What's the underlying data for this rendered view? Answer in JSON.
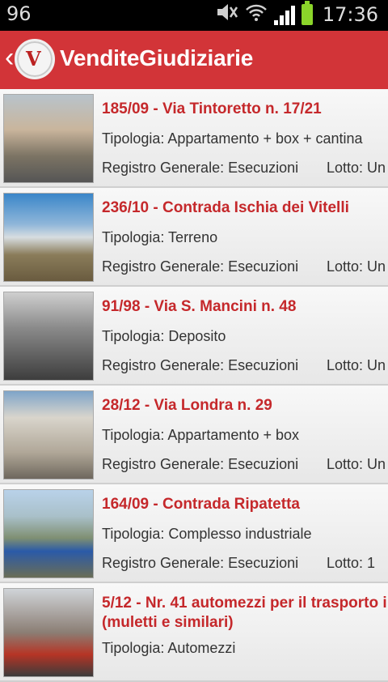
{
  "status_bar": {
    "left_text": "96",
    "time": "17:36",
    "icons": [
      "mute-icon",
      "wifi-icon",
      "signal-icon",
      "battery-icon"
    ]
  },
  "app_bar": {
    "title": "VenditeGiudiziarie",
    "back_icon": "chevron-left-icon",
    "logo_letter": "V"
  },
  "listings": [
    {
      "title": "185/09 - Via Tintoretto n. 17/21",
      "tipologia": "Tipologia: Appartamento + box + cantina",
      "registro": "Registro Generale: Esecuzioni",
      "lotto": "Lotto: Un"
    },
    {
      "title": "236/10 - Contrada Ischia dei Vitelli",
      "tipologia": "Tipologia: Terreno",
      "registro": "Registro Generale: Esecuzioni",
      "lotto": "Lotto: Un"
    },
    {
      "title": "91/98 - Via S. Mancini n. 48",
      "tipologia": "Tipologia: Deposito",
      "registro": "Registro Generale: Esecuzioni",
      "lotto": "Lotto: Un"
    },
    {
      "title": "28/12 - Via Londra n. 29",
      "tipologia": "Tipologia: Appartamento + box",
      "registro": "Registro Generale: Esecuzioni",
      "lotto": "Lotto: Un"
    },
    {
      "title": "164/09 - Contrada Ripatetta",
      "tipologia": "Tipologia: Complesso industriale",
      "registro": "Registro Generale: Esecuzioni",
      "lotto": "Lotto: 1"
    },
    {
      "title": "5/12 - Nr. 41 automezzi per il trasporto i (muletti e similari)",
      "tipologia": "Tipologia: Automezzi",
      "registro": "",
      "lotto": ""
    }
  ]
}
